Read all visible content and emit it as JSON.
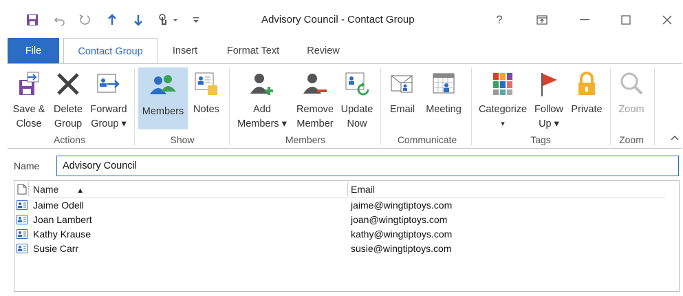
{
  "window": {
    "title": "Advisory Council  -  Contact Group",
    "help_label": "?"
  },
  "tabs": [
    {
      "label": "File"
    },
    {
      "label": "Contact Group"
    },
    {
      "label": "Insert"
    },
    {
      "label": "Format Text"
    },
    {
      "label": "Review"
    }
  ],
  "ribbon": {
    "groups": {
      "actions": "Actions",
      "show": "Show",
      "members": "Members",
      "communicate": "Communicate",
      "tags": "Tags",
      "zoom": "Zoom"
    },
    "save_close": [
      "Save &",
      "Close"
    ],
    "delete_group": [
      "Delete",
      "Group"
    ],
    "forward_group": [
      "Forward",
      "Group ▾"
    ],
    "members": [
      "Members"
    ],
    "notes": [
      "Notes"
    ],
    "add_members": [
      "Add",
      "Members ▾"
    ],
    "remove_member": [
      "Remove",
      "Member"
    ],
    "update_now": [
      "Update",
      "Now"
    ],
    "email": [
      "Email"
    ],
    "meeting": [
      "Meeting"
    ],
    "categorize": [
      "Categorize",
      "▾"
    ],
    "follow_up": [
      "Follow",
      "Up ▾"
    ],
    "private": [
      "Private"
    ],
    "zoom": [
      "Zoom"
    ]
  },
  "form": {
    "name_label": "Name",
    "name_value": "Advisory Council"
  },
  "list": {
    "columns": {
      "name": "Name",
      "email": "Email"
    },
    "sort_indicator": "▲",
    "rows": [
      {
        "name": "Jaime Odell",
        "email": "jaime@wingtiptoys.com"
      },
      {
        "name": "Joan Lambert",
        "email": "joan@wingtiptoys.com"
      },
      {
        "name": "Kathy Krause",
        "email": "kathy@wingtiptoys.com"
      },
      {
        "name": "Susie Carr",
        "email": "susie@wingtiptoys.com"
      }
    ]
  },
  "colors": {
    "accent": "#2b6cc4",
    "selected_button": "#c5dcf0",
    "save_purple": "#7b4aa0",
    "red": "#d9412b",
    "green": "#3aa35a"
  },
  "icons": [
    "save-icon",
    "undo-icon",
    "redo-icon",
    "up-arrow-icon",
    "down-arrow-icon",
    "touch-mode-icon",
    "customize-qat-icon"
  ]
}
